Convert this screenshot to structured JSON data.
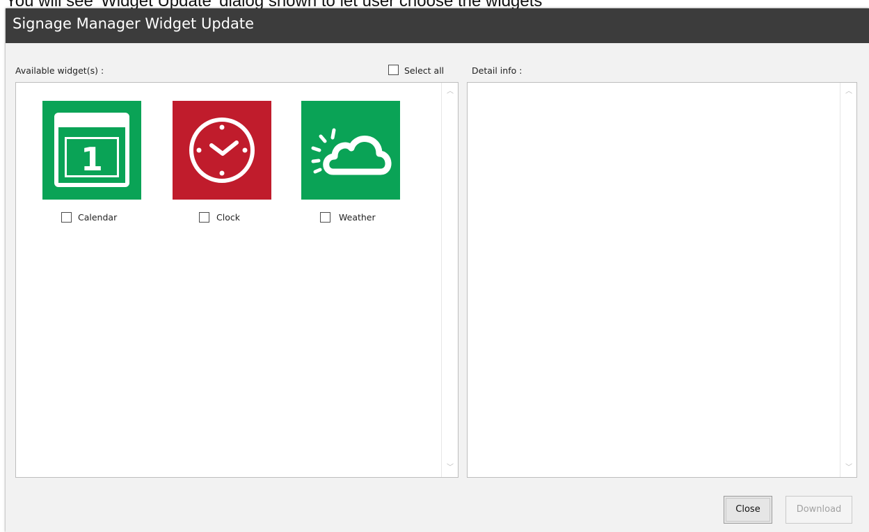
{
  "caption": "You will see 'Widget Update' dialog shown to let user choose the widgets",
  "dialog": {
    "title": "Signage Manager Widget Update",
    "available_label": "Available widget(s) :",
    "select_all_label": "Select all",
    "detail_label": "Detail info :",
    "widgets": [
      {
        "name": "Calendar",
        "icon": "calendar-icon",
        "color": "#0aa356",
        "icon_text": "1"
      },
      {
        "name": "Clock",
        "icon": "clock-icon",
        "color": "#c01c2c"
      },
      {
        "name": "Weather",
        "icon": "weather-icon",
        "color": "#0aa356"
      }
    ],
    "buttons": {
      "close": "Close",
      "download": "Download"
    }
  },
  "colors": {
    "titlebar": "#3c3c3c",
    "green": "#0aa356",
    "red": "#c01c2c"
  }
}
